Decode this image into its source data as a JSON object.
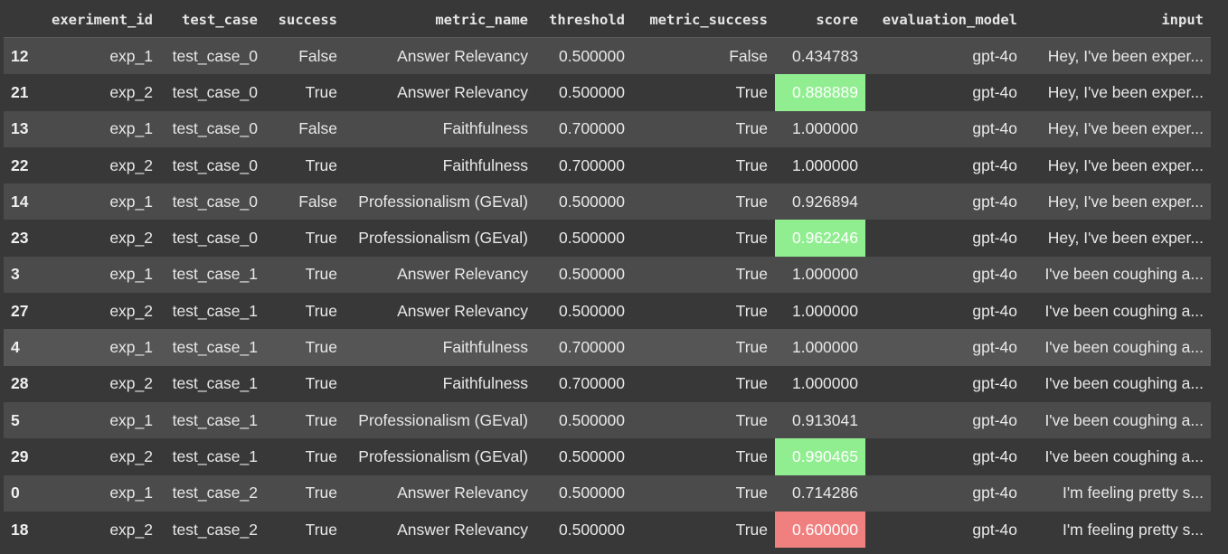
{
  "columns": [
    "exeriment_id",
    "test_case",
    "success",
    "metric_name",
    "threshold",
    "metric_success",
    "score",
    "evaluation_model",
    "input"
  ],
  "rows": [
    {
      "idx": "12",
      "exeriment_id": "exp_1",
      "test_case": "test_case_0",
      "success": "False",
      "metric_name": "Answer Relevancy",
      "threshold": "0.500000",
      "metric_success": "False",
      "score": "0.434783",
      "score_status": "none",
      "evaluation_model": "gpt-4o",
      "input": "Hey, I've been exper..."
    },
    {
      "idx": "21",
      "exeriment_id": "exp_2",
      "test_case": "test_case_0",
      "success": "True",
      "metric_name": "Answer Relevancy",
      "threshold": "0.500000",
      "metric_success": "True",
      "score": "0.888889",
      "score_status": "good",
      "evaluation_model": "gpt-4o",
      "input": "Hey, I've been exper..."
    },
    {
      "idx": "13",
      "exeriment_id": "exp_1",
      "test_case": "test_case_0",
      "success": "False",
      "metric_name": "Faithfulness",
      "threshold": "0.700000",
      "metric_success": "True",
      "score": "1.000000",
      "score_status": "none",
      "evaluation_model": "gpt-4o",
      "input": "Hey, I've been exper..."
    },
    {
      "idx": "22",
      "exeriment_id": "exp_2",
      "test_case": "test_case_0",
      "success": "True",
      "metric_name": "Faithfulness",
      "threshold": "0.700000",
      "metric_success": "True",
      "score": "1.000000",
      "score_status": "none",
      "evaluation_model": "gpt-4o",
      "input": "Hey, I've been exper..."
    },
    {
      "idx": "14",
      "exeriment_id": "exp_1",
      "test_case": "test_case_0",
      "success": "False",
      "metric_name": "Professionalism (GEval)",
      "threshold": "0.500000",
      "metric_success": "True",
      "score": "0.926894",
      "score_status": "none",
      "evaluation_model": "gpt-4o",
      "input": "Hey, I've been exper..."
    },
    {
      "idx": "23",
      "exeriment_id": "exp_2",
      "test_case": "test_case_0",
      "success": "True",
      "metric_name": "Professionalism (GEval)",
      "threshold": "0.500000",
      "metric_success": "True",
      "score": "0.962246",
      "score_status": "good",
      "evaluation_model": "gpt-4o",
      "input": "Hey, I've been exper..."
    },
    {
      "idx": "3",
      "exeriment_id": "exp_1",
      "test_case": "test_case_1",
      "success": "True",
      "metric_name": "Answer Relevancy",
      "threshold": "0.500000",
      "metric_success": "True",
      "score": "1.000000",
      "score_status": "none",
      "evaluation_model": "gpt-4o",
      "input": "I've been coughing a..."
    },
    {
      "idx": "27",
      "exeriment_id": "exp_2",
      "test_case": "test_case_1",
      "success": "True",
      "metric_name": "Answer Relevancy",
      "threshold": "0.500000",
      "metric_success": "True",
      "score": "1.000000",
      "score_status": "none",
      "evaluation_model": "gpt-4o",
      "input": "I've been coughing a..."
    },
    {
      "idx": "4",
      "exeriment_id": "exp_1",
      "test_case": "test_case_1",
      "success": "True",
      "metric_name": "Faithfulness",
      "threshold": "0.700000",
      "metric_success": "True",
      "score": "1.000000",
      "score_status": "none",
      "evaluation_model": "gpt-4o",
      "input": "I've been coughing a..."
    },
    {
      "idx": "28",
      "exeriment_id": "exp_2",
      "test_case": "test_case_1",
      "success": "True",
      "metric_name": "Faithfulness",
      "threshold": "0.700000",
      "metric_success": "True",
      "score": "1.000000",
      "score_status": "none",
      "evaluation_model": "gpt-4o",
      "input": "I've been coughing a..."
    },
    {
      "idx": "5",
      "exeriment_id": "exp_1",
      "test_case": "test_case_1",
      "success": "True",
      "metric_name": "Professionalism (GEval)",
      "threshold": "0.500000",
      "metric_success": "True",
      "score": "0.913041",
      "score_status": "none",
      "evaluation_model": "gpt-4o",
      "input": "I've been coughing a..."
    },
    {
      "idx": "29",
      "exeriment_id": "exp_2",
      "test_case": "test_case_1",
      "success": "True",
      "metric_name": "Professionalism (GEval)",
      "threshold": "0.500000",
      "metric_success": "True",
      "score": "0.990465",
      "score_status": "good",
      "evaluation_model": "gpt-4o",
      "input": "I've been coughing a..."
    },
    {
      "idx": "0",
      "exeriment_id": "exp_1",
      "test_case": "test_case_2",
      "success": "True",
      "metric_name": "Answer Relevancy",
      "threshold": "0.500000",
      "metric_success": "True",
      "score": "0.714286",
      "score_status": "none",
      "evaluation_model": "gpt-4o",
      "input": "I'm feeling pretty s..."
    },
    {
      "idx": "18",
      "exeriment_id": "exp_2",
      "test_case": "test_case_2",
      "success": "True",
      "metric_name": "Answer Relevancy",
      "threshold": "0.500000",
      "metric_success": "True",
      "score": "0.600000",
      "score_status": "bad",
      "evaluation_model": "gpt-4o",
      "input": "I'm feeling pretty s..."
    }
  ],
  "hovered_row": 8,
  "colors": {
    "background": "#383838",
    "row_alt": "#4b4b4b",
    "row_hover": "#555555",
    "good": "#90ee90",
    "bad": "#f08080"
  }
}
